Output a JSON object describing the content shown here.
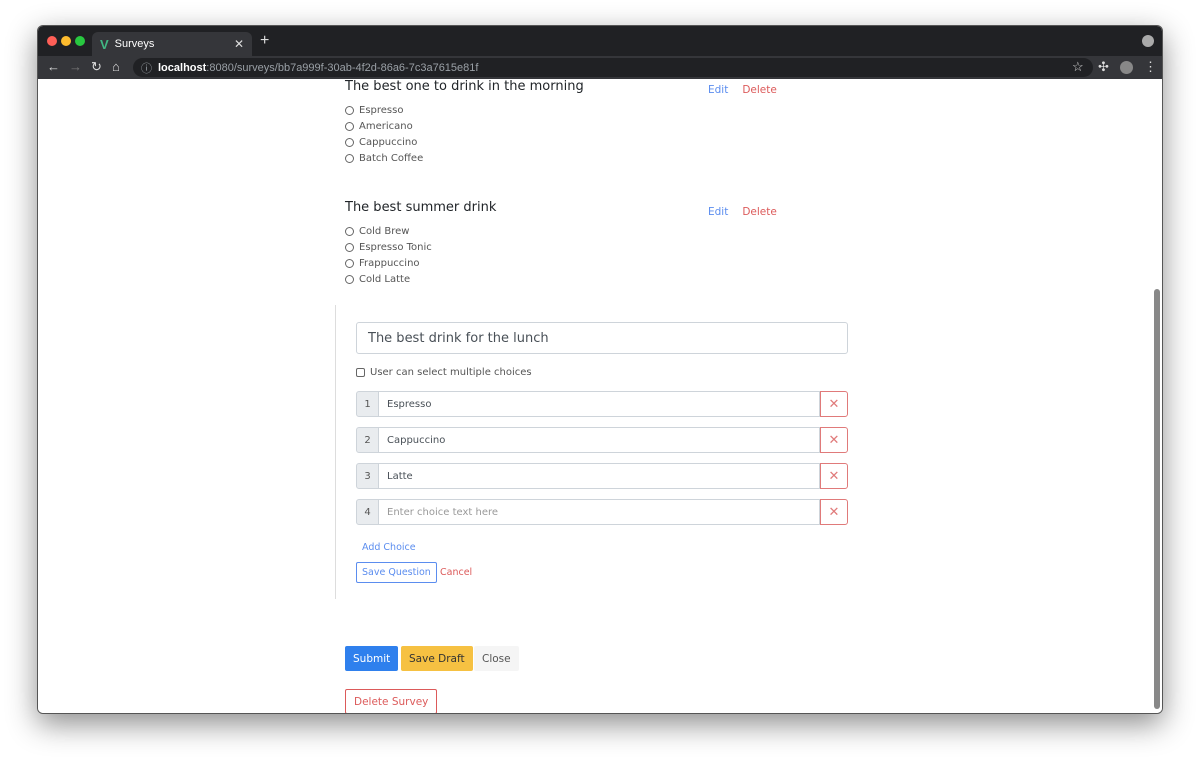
{
  "browser": {
    "tab_title": "Surveys",
    "url_host": "localhost",
    "url_rest": ":8080/surveys/bb7a999f-30ab-4f2d-86a6-7c3a7615e81f"
  },
  "questions": [
    {
      "title": "The best one to drink in the morning",
      "options": [
        "Espresso",
        "Americano",
        "Cappuccino",
        "Batch Coffee"
      ],
      "edit": "Edit",
      "delete": "Delete"
    },
    {
      "title": "The best summer drink",
      "options": [
        "Cold Brew",
        "Espresso Tonic",
        "Frappuccino",
        "Cold Latte"
      ],
      "edit": "Edit",
      "delete": "Delete"
    }
  ],
  "editor": {
    "question_value": "The best drink for the lunch",
    "multiple_label": "User can select multiple choices",
    "multiple_checked": false,
    "choices": [
      {
        "n": "1",
        "value": "Espresso"
      },
      {
        "n": "2",
        "value": "Cappuccino"
      },
      {
        "n": "3",
        "value": "Latte"
      },
      {
        "n": "4",
        "value": "",
        "placeholder": "Enter choice text here"
      }
    ],
    "add_choice": "Add Choice",
    "save_question": "Save Question",
    "cancel": "Cancel"
  },
  "actions": {
    "submit": "Submit",
    "save_draft": "Save Draft",
    "close": "Close",
    "delete_survey": "Delete Survey"
  },
  "colors": {
    "primary": "#2f80ed",
    "warning": "#f6c142",
    "danger": "#dc5a5a"
  }
}
